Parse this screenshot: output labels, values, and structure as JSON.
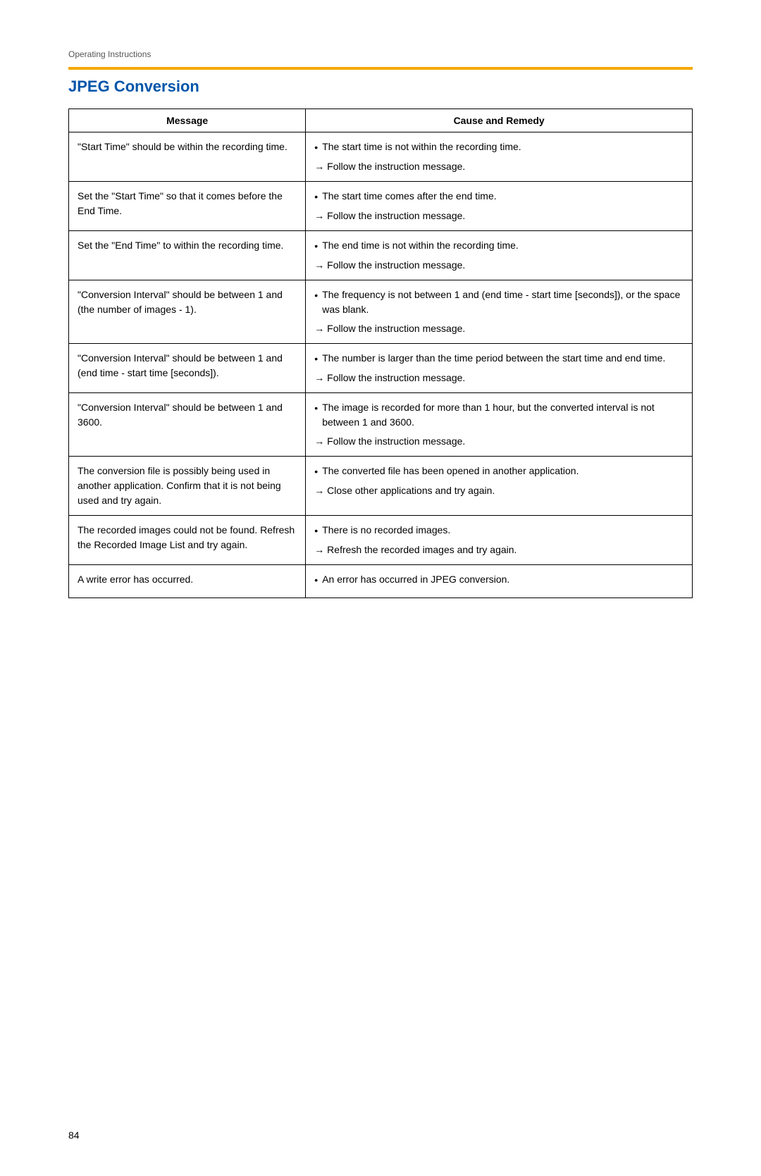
{
  "meta": {
    "breadcrumb": "Operating Instructions",
    "page_number": "84",
    "accent_color": "#F5A800",
    "title_color": "#0055AA"
  },
  "title": "JPEG Conversion",
  "table": {
    "col1_header": "Message",
    "col2_header": "Cause and Remedy",
    "rows": [
      {
        "message": "\"Start Time\" should be within the recording time.",
        "causes": [
          "The start time is not within the recording time.",
          "→ Follow the instruction message."
        ]
      },
      {
        "message": "Set the \"Start Time\" so that it comes before the End Time.",
        "causes": [
          "The start time comes after the end time.",
          "→ Follow the instruction message."
        ]
      },
      {
        "message": "Set the \"End Time\" to within the recording time.",
        "causes": [
          "The end time is not within the recording time.",
          "→ Follow the instruction message."
        ]
      },
      {
        "message": "\"Conversion Interval\" should be between 1 and (the number of images - 1).",
        "causes": [
          "The frequency is not between 1 and (end time - start time [seconds]), or the space was blank.",
          "→ Follow the instruction message."
        ]
      },
      {
        "message": "\"Conversion Interval\" should be between 1 and (end time - start time [seconds]).",
        "causes": [
          "The number is larger than the time period between the start time and end time.",
          "→ Follow the instruction message."
        ]
      },
      {
        "message": "\"Conversion Interval\" should be between 1 and 3600.",
        "causes": [
          "The image is recorded for more than 1 hour, but the converted interval is not between 1 and 3600.",
          "→ Follow the instruction message."
        ]
      },
      {
        "message": "The conversion file is possibly being used in another application. Confirm that it is not being used and try again.",
        "causes": [
          "The converted file has been opened in another application.",
          "→ Close other applications and try again."
        ]
      },
      {
        "message": "The recorded images could not be found. Refresh the Recorded Image List and try again.",
        "causes": [
          "There is no recorded images.",
          "→ Refresh the recorded images and try again."
        ]
      },
      {
        "message": "A write error has occurred.",
        "causes": [
          "An error has occurred in JPEG conversion."
        ]
      }
    ]
  }
}
